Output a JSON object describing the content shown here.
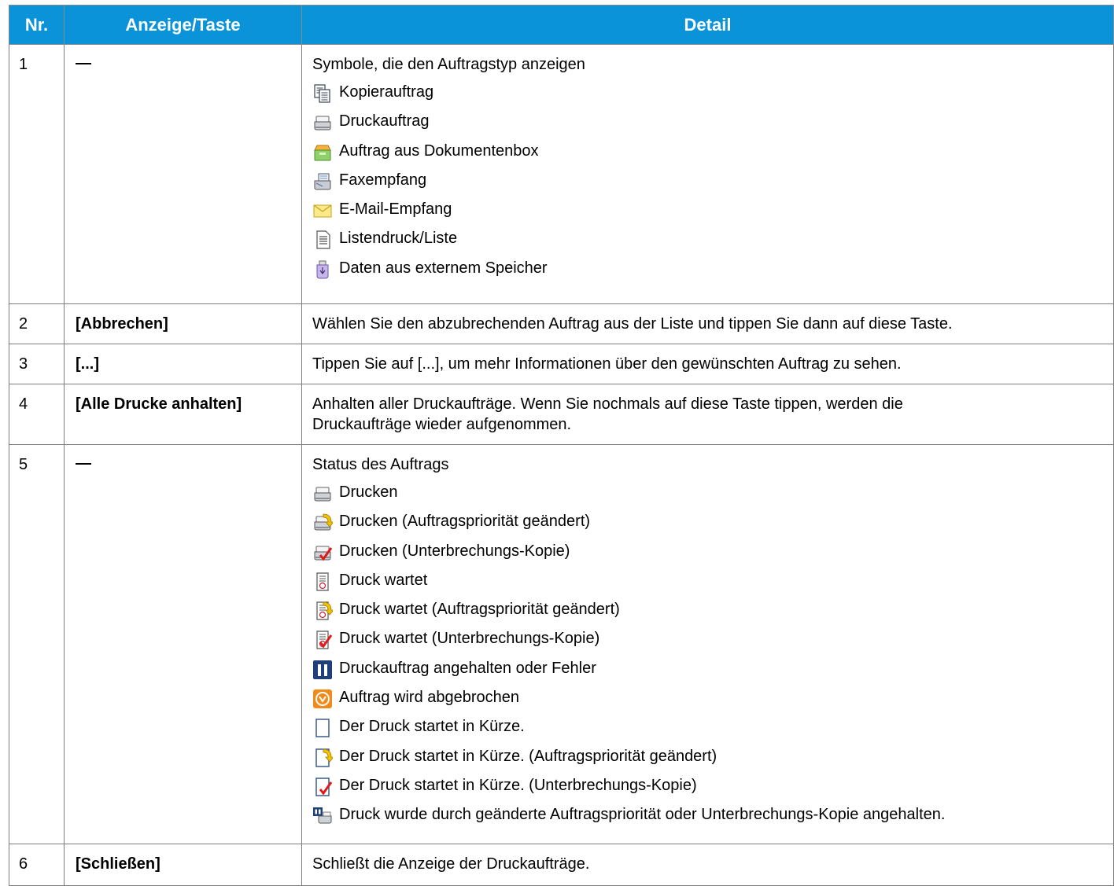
{
  "header": {
    "col_nr": "Nr.",
    "col_key": "Anzeige/Taste",
    "col_detail": "Detail"
  },
  "rows": [
    {
      "nr": "1",
      "key": "—",
      "detail_intro": "Symbole, die den Auftragstyp anzeigen",
      "items": [
        {
          "icon": "copy-job-icon",
          "label": "Kopierauftrag"
        },
        {
          "icon": "print-job-icon",
          "label": "Druckauftrag"
        },
        {
          "icon": "document-box-icon",
          "label": "Auftrag aus Dokumentenbox"
        },
        {
          "icon": "fax-receive-icon",
          "label": "Faxempfang"
        },
        {
          "icon": "email-envelope-icon",
          "label": "E-Mail-Empfang"
        },
        {
          "icon": "list-document-icon",
          "label": "Listendruck/Liste"
        },
        {
          "icon": "usb-memory-icon",
          "label": "Daten aus externem Speicher"
        }
      ]
    },
    {
      "nr": "2",
      "key": "[Abbrechen]",
      "detail": "Wählen Sie den abzubrechenden Auftrag aus der Liste und tippen Sie dann auf diese Taste."
    },
    {
      "nr": "3",
      "key": "[...]",
      "detail": "Tippen Sie auf [...], um mehr Informationen über den gewünschten Auftrag zu sehen."
    },
    {
      "nr": "4",
      "key": "[Alle Drucke anhalten]",
      "detail_line1": "Anhalten aller Druckaufträge. Wenn Sie nochmals auf diese Taste tippen, werden die",
      "detail_line2": "Druckaufträge wieder aufgenommen."
    },
    {
      "nr": "5",
      "key": "—",
      "detail_intro": "Status des Auftrags",
      "items": [
        {
          "icon": "printing-icon",
          "label": "Drucken"
        },
        {
          "icon": "printing-priority-icon",
          "label": "Drucken (Auftragspriorität geändert)"
        },
        {
          "icon": "printing-interrupt-icon",
          "label": "Drucken (Unterbrechungs-Kopie)"
        },
        {
          "icon": "print-waiting-icon",
          "label": "Druck wartet"
        },
        {
          "icon": "print-waiting-priority-icon",
          "label": "Druck wartet (Auftragspriorität geändert)"
        },
        {
          "icon": "print-waiting-interrupt-icon",
          "label": "Druck wartet (Unterbrechungs-Kopie)"
        },
        {
          "icon": "pause-icon",
          "label": "Druckauftrag angehalten oder Fehler"
        },
        {
          "icon": "cancel-stop-icon",
          "label": "Auftrag wird abgebrochen"
        },
        {
          "icon": "blank-page-icon",
          "label": "Der Druck startet in Kürze."
        },
        {
          "icon": "blank-page-priority-icon",
          "label": "Der Druck startet in Kürze. (Auftragspriorität geändert)"
        },
        {
          "icon": "blank-page-interrupt-icon",
          "label": "Der Druck startet in Kürze. (Unterbrechungs-Kopie)"
        },
        {
          "icon": "printer-paused-icon",
          "label": "Druck wurde durch geänderte Auftragspriorität oder Unterbrechungs-Kopie angehalten."
        }
      ]
    },
    {
      "nr": "6",
      "key": "[Schließen]",
      "detail": "Schließt die Anzeige der Druckaufträge."
    }
  ]
}
